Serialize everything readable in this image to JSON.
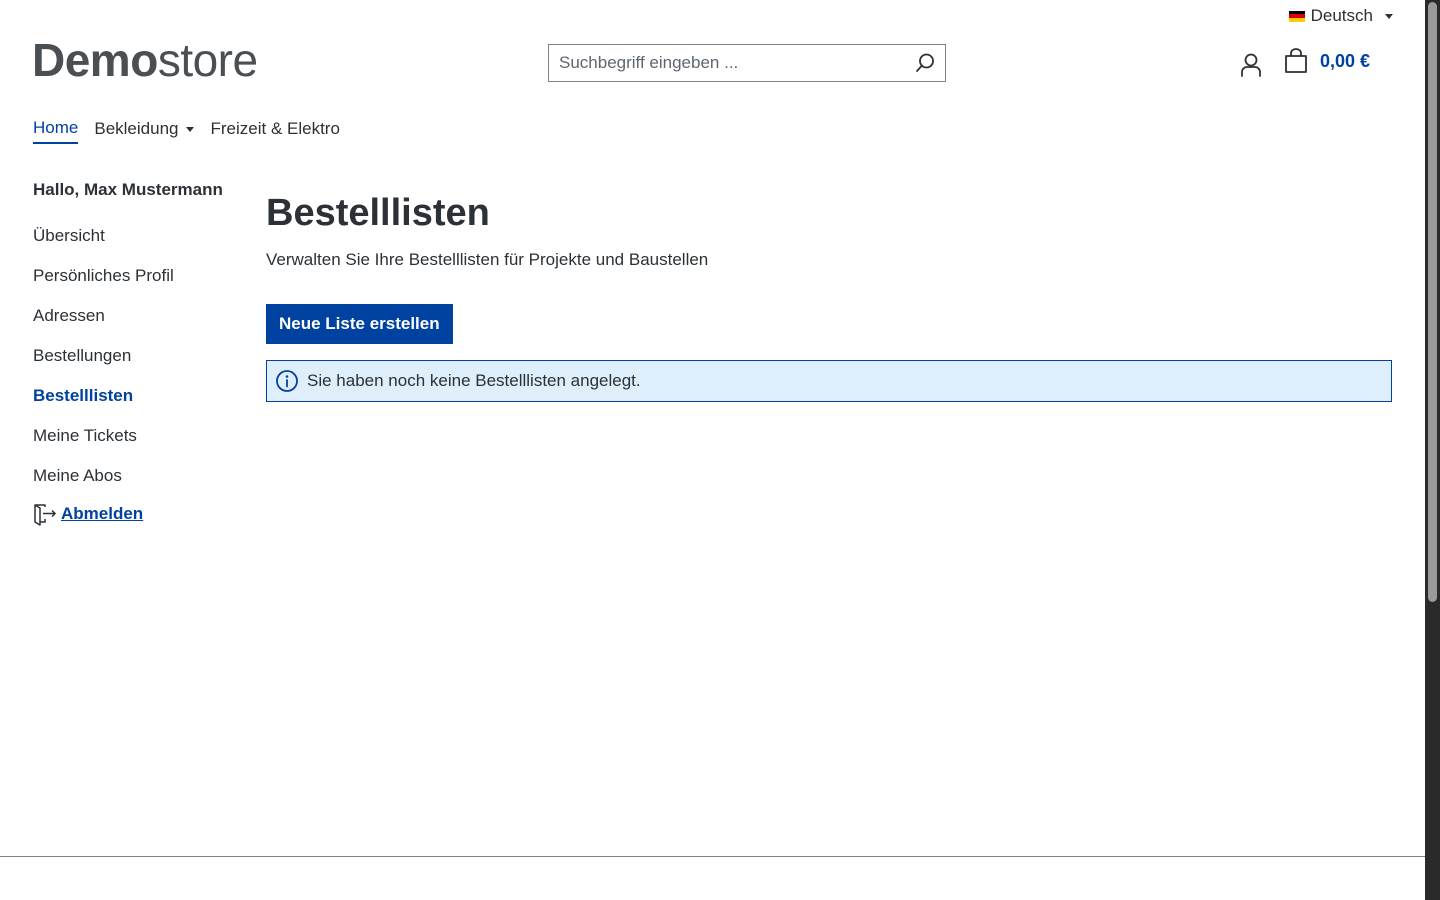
{
  "topbar": {
    "language_label": "Deutsch",
    "flag_colors": [
      "#000000",
      "#dd0000",
      "#ffce00"
    ]
  },
  "header": {
    "logo_bold": "Demo",
    "logo_light": "store",
    "search_placeholder": "Suchbegriff eingeben ...",
    "search_icon": "search-icon",
    "account_icon": "user-icon",
    "cart_icon": "shopping-bag-icon",
    "cart_total": "0,00 €"
  },
  "main_nav": {
    "items": [
      {
        "label": "Home",
        "active": true
      },
      {
        "label": "Bekleidung",
        "has_dropdown": true
      },
      {
        "label": "Freizeit & Elektro"
      }
    ]
  },
  "sidebar": {
    "greeting": "Hallo, Max Mustermann",
    "items": [
      {
        "label": "Übersicht"
      },
      {
        "label": "Persönliches Profil"
      },
      {
        "label": "Adressen"
      },
      {
        "label": "Bestellungen"
      },
      {
        "label": "Bestelllisten",
        "active": true
      },
      {
        "label": "Meine Tickets"
      },
      {
        "label": "Meine Abos"
      }
    ],
    "logout_label": "Abmelden",
    "logout_icon": "logout-icon"
  },
  "main": {
    "title": "Bestelllisten",
    "description": "Verwalten Sie Ihre Bestelllisten für Projekte und Baustellen",
    "create_button_label": "Neue Liste erstellen",
    "info_icon": "info-icon",
    "empty_message": "Sie haben noch keine Bestelllisten angelegt."
  },
  "colors": {
    "primary": "#0042a0",
    "text": "#2b3136",
    "alert_background": "#deeefa"
  }
}
